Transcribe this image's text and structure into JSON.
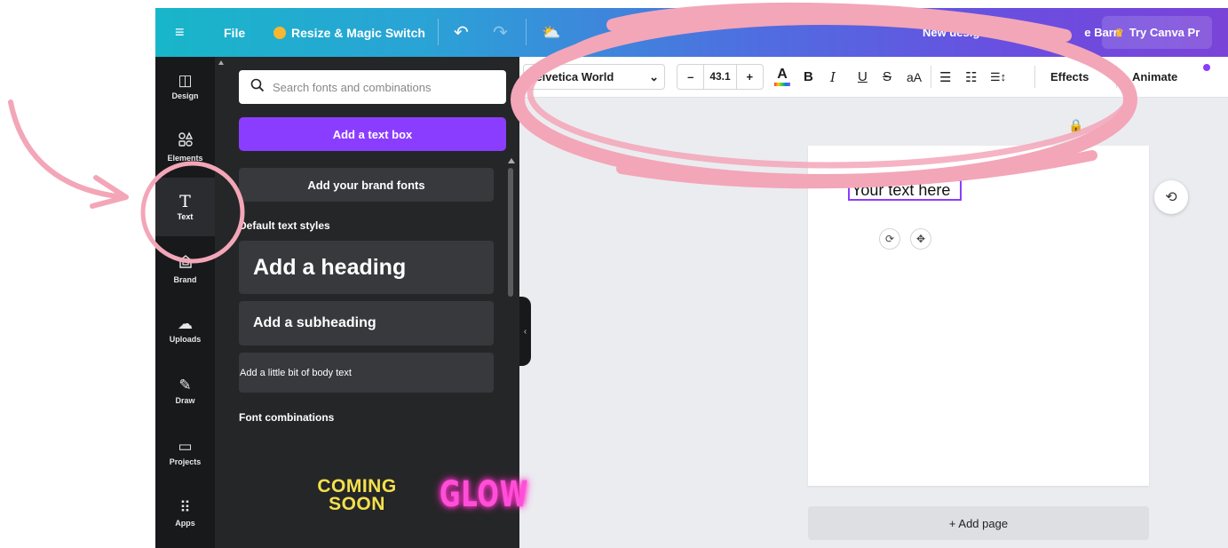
{
  "topbar": {
    "menu_icon": "≡",
    "file": "File",
    "resize": "Resize & Magic Switch",
    "undo_icon": "↶",
    "redo_icon": "↷",
    "cloud_icon": "⛅",
    "title_partial": "New design",
    "title_suffix_partial": "e Barn",
    "try_pro": "Try Canva Pr",
    "try_pro_icon": "♛"
  },
  "rail": {
    "items": [
      {
        "icon": "◫",
        "label": "Design"
      },
      {
        "icon": "⌂",
        "label": "Elements"
      },
      {
        "icon": "T",
        "label": "Text"
      },
      {
        "icon": "⌂",
        "label": "Brand"
      },
      {
        "icon": "☁",
        "label": "Uploads"
      },
      {
        "icon": "✎",
        "label": "Draw"
      },
      {
        "icon": "▭",
        "label": "Projects"
      },
      {
        "icon": "⠿",
        "label": "Apps"
      }
    ]
  },
  "panel": {
    "search_placeholder": "Search fonts and combinations",
    "add_text_box": "Add a text box",
    "add_brand_fonts": "Add your brand fonts",
    "default_styles_label": "Default text styles",
    "heading": "Add a heading",
    "subheading": "Add a subheading",
    "body": "Add a little bit of body text",
    "font_combinations_label": "Font combinations",
    "combo_1": "COMING SOON",
    "combo_2": "GLOW",
    "collapse_icon": "‹"
  },
  "toolbar": {
    "font": "Helvetica World",
    "font_chevron": "⌄",
    "minus": "–",
    "size": "43.1",
    "plus": "+",
    "color_a": "A",
    "bold": "B",
    "italic": "I",
    "underline": "U",
    "strike": "S",
    "case": "aA",
    "align_icon": "☰",
    "list_icon": "☷",
    "spacing_icon": "☰↕",
    "effects": "Effects",
    "animate": "Animate"
  },
  "canvas": {
    "lock_icon": "🔒",
    "text_value": "Your text here",
    "rotate_icon": "⟳",
    "move_icon": "✥",
    "refresh_icon": "⟲",
    "add_page": "+ Add page"
  },
  "colors": {
    "brand_purple": "#8b3dff",
    "annotation_pink": "#f3a6b8",
    "panel_bg": "#252627",
    "rail_bg": "#18191b"
  }
}
